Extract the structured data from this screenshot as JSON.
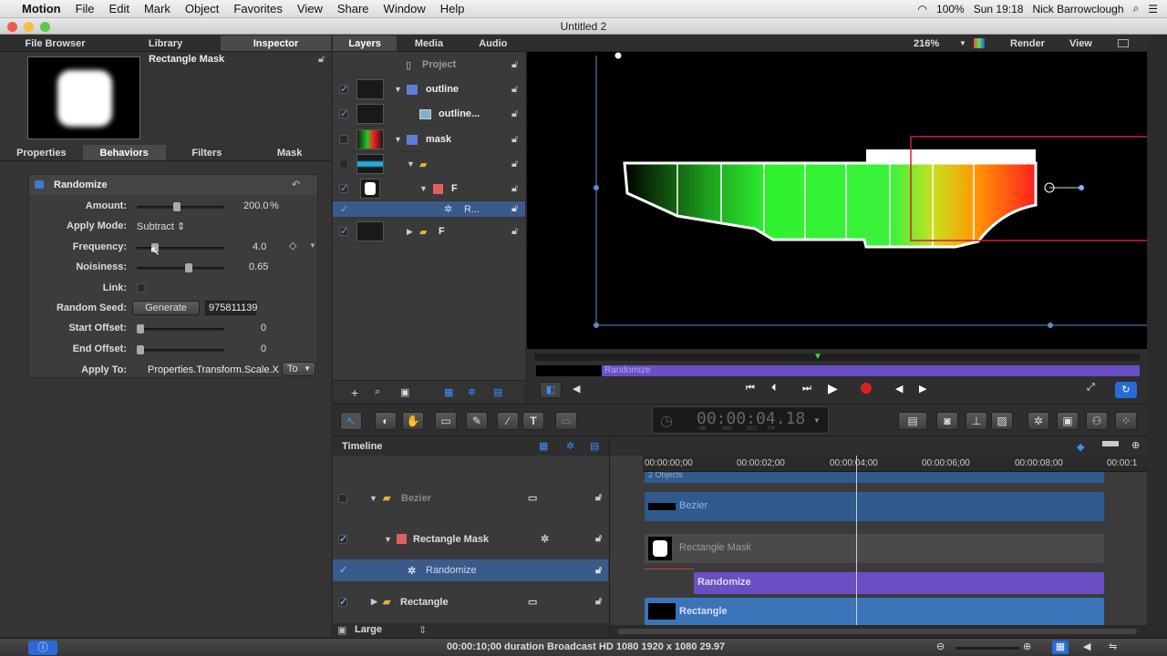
{
  "menubar": {
    "apple": "",
    "app": "Motion",
    "items": [
      "File",
      "Edit",
      "Mark",
      "Object",
      "Favorites",
      "View",
      "Share",
      "Window",
      "Help"
    ],
    "battery": "100%",
    "clock": "Sun 19:18",
    "user": "Nick Barrowclough"
  },
  "window": {
    "title": "Untitled 2"
  },
  "left_panel": {
    "tabs": [
      "File Browser",
      "Library",
      "Inspector"
    ],
    "preview_title": "Rectangle Mask",
    "subtabs": [
      "Properties",
      "Behaviors",
      "Filters",
      "Mask"
    ],
    "behavior": {
      "name": "Randomize",
      "amount_label": "Amount:",
      "amount_value": "200.0",
      "amount_unit": "%",
      "amount_level": 0.45,
      "apply_mode_label": "Apply Mode:",
      "apply_mode_value": "Subtract",
      "frequency_label": "Frequency:",
      "frequency_value": "4.0",
      "frequency_level": 0.18,
      "noisiness_label": "Noisiness:",
      "noisiness_value": "0.65",
      "noisiness_level": 0.6,
      "link_label": "Link:",
      "seed_label": "Random Seed:",
      "generate_label": "Generate",
      "seed_value": "975811139",
      "start_label": "Start Offset:",
      "start_value": "0",
      "end_label": "End Offset:",
      "end_value": "0",
      "apply_to_label": "Apply To:",
      "apply_to_value": "Properties.Transform.Scale.X",
      "to_label": "To"
    }
  },
  "layers_panel": {
    "tabs": [
      "Layers",
      "Media",
      "Audio"
    ],
    "project": "Project",
    "rows": [
      {
        "name": "outline"
      },
      {
        "name": "outline..."
      },
      {
        "name": "mask"
      },
      {
        "name": ""
      },
      {
        "name": "F"
      },
      {
        "name": "R..."
      },
      {
        "name": "F"
      }
    ]
  },
  "canvas": {
    "zoom": "216%",
    "render": "Render",
    "view": "View",
    "mini_bar_label": "Randomize"
  },
  "toolbar": {
    "timecode": "00:00:04.18",
    "tc_labels": [
      "HR",
      "MIN",
      "SEC",
      "FR"
    ]
  },
  "timeline": {
    "title": "Timeline",
    "ruler": [
      "00:00:00;00",
      "00:00:02;00",
      "00:00:04;00",
      "00:00:06;00",
      "00:00:08;00",
      "00:00:1"
    ],
    "top_partial": "2 Objects",
    "rows": [
      "Bezier",
      "Rectangle Mask",
      "Randomize",
      "Rectangle"
    ],
    "bars": [
      "Bezier",
      "Rectangle Mask",
      "Randomize",
      "Rectangle"
    ],
    "size": "Large"
  },
  "status": {
    "text": "00:00:10;00 duration Broadcast HD 1080 1920 x 1080 29.97"
  },
  "colors": {
    "accent": "#3a7bd5",
    "purple": "#6a4fc4",
    "blue_bar": "#2f5a8e"
  }
}
